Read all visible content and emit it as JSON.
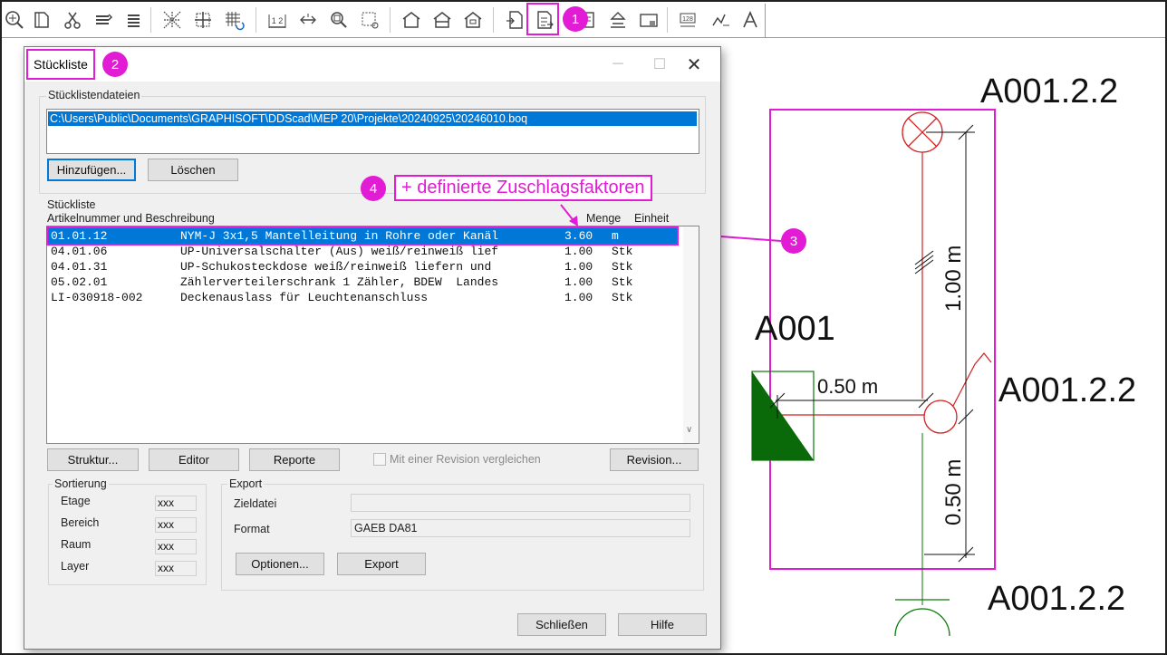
{
  "toolbar": {
    "icons": [
      "zoom-icon",
      "book-icon",
      "cut-tool-icon",
      "layer-stack-icon",
      "layer-stack-alt-icon",
      "grid-pattern-icon",
      "grid-cross-icon",
      "grid-refresh-icon",
      "dimension-icon",
      "distance-icon",
      "inspect-icon",
      "select-box-icon",
      "house-icon",
      "house-alt-icon",
      "house-roof-icon",
      "document-arrow-icon",
      "bill-of-materials-icon",
      "copy-doc-icon",
      "floor-icon",
      "panel-icon",
      "tag-128-icon",
      "chart-tag-icon",
      "text-a-icon"
    ],
    "tag_label": "128",
    "dim_label": "1 2"
  },
  "callouts": {
    "one": "1",
    "two": "2",
    "three": "3",
    "four": "4",
    "factors": "+ definierte Zuschlagsfaktoren"
  },
  "dialog": {
    "title": "Stückliste",
    "files_group": "Stücklistendateien",
    "file_path": "C:\\Users\\Public\\Documents\\GRAPHISOFT\\DDScad\\MEP 20\\Projekte\\20240925\\20246010.boq",
    "add_label": "Hinzufügen...",
    "delete_label": "Löschen",
    "list_group": "Stückliste",
    "col_article": "Artikelnummer und Beschreibung",
    "col_qty": "Menge",
    "col_unit": "Einheit",
    "rows": [
      {
        "nr": "01.01.12",
        "desc": "NYM-J 3x1,5 Mantelleitung in Rohre oder Kanäl",
        "qty": "3.60",
        "unit": "m"
      },
      {
        "nr": "04.01.06",
        "desc": "UP-Universalschalter (Aus) weiß/reinweiß lief",
        "qty": "1.00",
        "unit": "Stk"
      },
      {
        "nr": "04.01.31",
        "desc": "UP-Schukosteckdose weiß/reinweiß liefern und",
        "qty": "1.00",
        "unit": "Stk"
      },
      {
        "nr": "05.02.01",
        "desc": "Zählerverteilerschrank 1 Zähler, BDEW  Landes",
        "qty": "1.00",
        "unit": "Stk"
      },
      {
        "nr": "LI-030918-002",
        "desc": "Deckenauslass für Leuchtenanschluss",
        "qty": "1.00",
        "unit": "Stk"
      }
    ],
    "structure_label": "Struktur...",
    "editor_label": "Editor",
    "reports_label": "Reporte",
    "compare_label": "Mit einer Revision vergleichen",
    "revision_label": "Revision...",
    "sort_group": "Sortierung",
    "sort_items": [
      {
        "label": "Etage",
        "value": "xxx"
      },
      {
        "label": "Bereich",
        "value": "xxx"
      },
      {
        "label": "Raum",
        "value": "xxx"
      },
      {
        "label": "Layer",
        "value": "xxx"
      }
    ],
    "export_group": "Export",
    "target_label": "Zieldatei",
    "target_value": "",
    "format_label": "Format",
    "format_value": "GAEB DA81",
    "options_label": "Optionen...",
    "export_label": "Export",
    "close_label": "Schließen",
    "help_label": "Hilfe"
  },
  "drawing": {
    "label_a001": "A001",
    "label_top": "A001.2.2",
    "label_mid": "A001.2.2",
    "label_bottom": "A001.2.2",
    "dim_horizontal": "0.50 m",
    "dim_vertical_top": "1.00 m",
    "dim_vertical_bottom": "0.50 m"
  },
  "colors": {
    "highlight": "#e21bd4",
    "selection": "#0078d7",
    "wire": "#d42020",
    "green": "#0a7a0a"
  }
}
